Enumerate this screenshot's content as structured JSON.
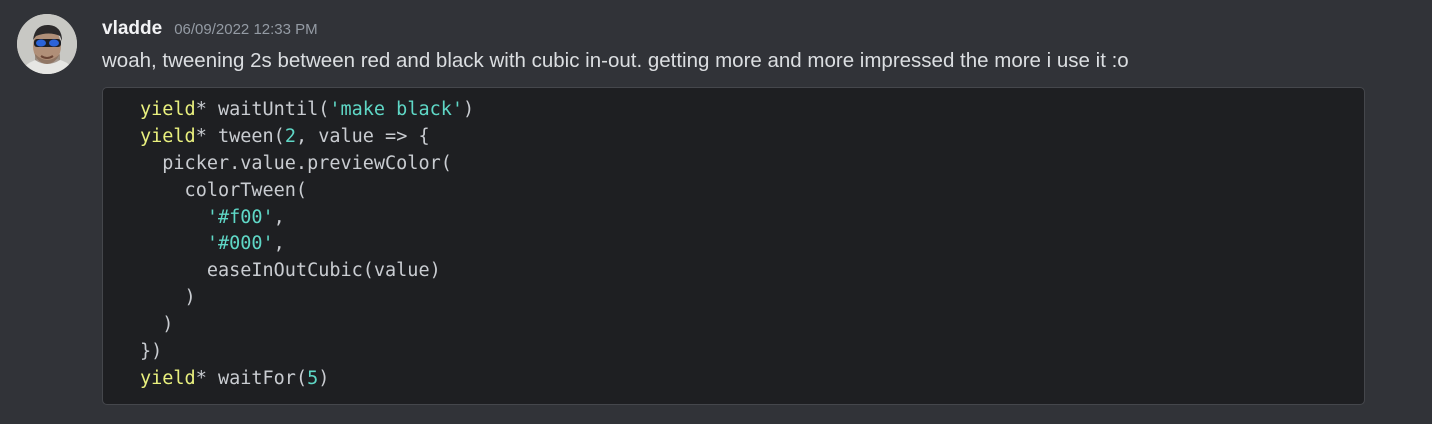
{
  "message": {
    "username": "vladde",
    "timestamp": "06/09/2022 12:33 PM",
    "text": "woah, tweening 2s between red and black with cubic in-out. getting more and more impressed the more i use it :o"
  },
  "code": {
    "lines": [
      [
        {
          "t": "kw",
          "v": "yield"
        },
        {
          "t": "plain",
          "v": "* waitUntil("
        },
        {
          "t": "str",
          "v": "'make black'"
        },
        {
          "t": "plain",
          "v": ")"
        }
      ],
      [
        {
          "t": "kw",
          "v": "yield"
        },
        {
          "t": "plain",
          "v": "* tween("
        },
        {
          "t": "num",
          "v": "2"
        },
        {
          "t": "plain",
          "v": ", value => {"
        }
      ],
      [
        {
          "t": "plain",
          "v": "  picker.value.previewColor("
        }
      ],
      [
        {
          "t": "plain",
          "v": "    colorTween("
        }
      ],
      [
        {
          "t": "plain",
          "v": "      "
        },
        {
          "t": "str",
          "v": "'#f00'"
        },
        {
          "t": "plain",
          "v": ","
        }
      ],
      [
        {
          "t": "plain",
          "v": "      "
        },
        {
          "t": "str",
          "v": "'#000'"
        },
        {
          "t": "plain",
          "v": ","
        }
      ],
      [
        {
          "t": "plain",
          "v": "      easeInOutCubic(value)"
        }
      ],
      [
        {
          "t": "plain",
          "v": "    )"
        }
      ],
      [
        {
          "t": "plain",
          "v": "  )"
        }
      ],
      [
        {
          "t": "plain",
          "v": "})"
        }
      ],
      [
        {
          "t": "kw",
          "v": "yield"
        },
        {
          "t": "plain",
          "v": "* waitFor("
        },
        {
          "t": "num",
          "v": "5"
        },
        {
          "t": "plain",
          "v": ")"
        }
      ]
    ]
  },
  "colors": {
    "background": "#313338",
    "code_background": "#1e1f22",
    "keyword": "#e9f07e",
    "string": "#5fd7c6",
    "text": "#dbdee1"
  }
}
